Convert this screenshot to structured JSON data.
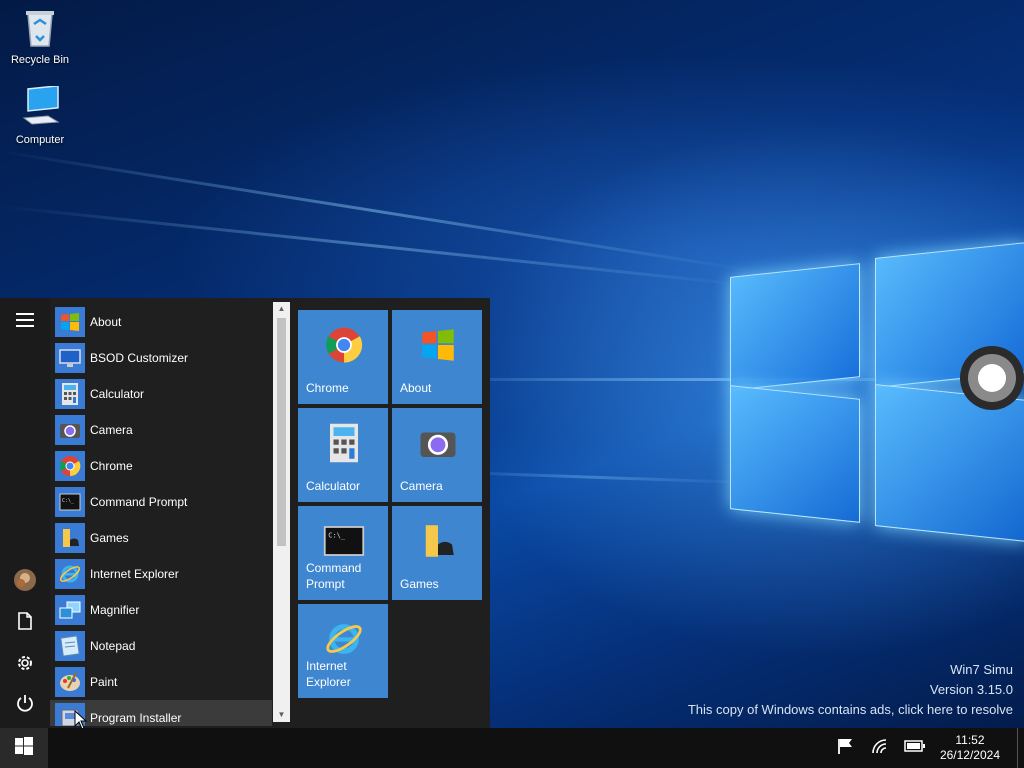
{
  "desktop": {
    "icons": [
      {
        "label": "Recycle Bin",
        "icon": "recycle-bin-icon"
      },
      {
        "label": "Computer",
        "icon": "computer-icon"
      }
    ],
    "watermark": {
      "line1": "Win7 Simu",
      "line2": "Version 3.15.0",
      "line3": "This copy of Windows contains ads, click here to resolve"
    }
  },
  "start_menu": {
    "rail": [
      {
        "icon": "hamburger-menu-icon"
      },
      {
        "icon": "user-avatar-icon"
      },
      {
        "icon": "documents-icon"
      },
      {
        "icon": "settings-gear-icon"
      },
      {
        "icon": "power-icon"
      }
    ],
    "apps": [
      {
        "label": "About",
        "icon": "windows-flag-icon"
      },
      {
        "label": "BSOD Customizer",
        "icon": "monitor-icon"
      },
      {
        "label": "Calculator",
        "icon": "calculator-icon"
      },
      {
        "label": "Camera",
        "icon": "camera-icon"
      },
      {
        "label": "Chrome",
        "icon": "chrome-icon"
      },
      {
        "label": "Command Prompt",
        "icon": "command-prompt-icon"
      },
      {
        "label": "Games",
        "icon": "games-folder-icon"
      },
      {
        "label": "Internet Explorer",
        "icon": "internet-explorer-icon"
      },
      {
        "label": "Magnifier",
        "icon": "magnifier-icon"
      },
      {
        "label": "Notepad",
        "icon": "notepad-icon"
      },
      {
        "label": "Paint",
        "icon": "paint-palette-icon"
      },
      {
        "label": "Program Installer",
        "icon": "installer-icon"
      }
    ],
    "hovered_app": "Program Installer",
    "tiles": [
      {
        "label": "Chrome",
        "icon": "chrome-icon"
      },
      {
        "label": "About",
        "icon": "windows-flag-icon"
      },
      {
        "label": "Calculator",
        "icon": "calculator-icon"
      },
      {
        "label": "Camera",
        "icon": "camera-icon"
      },
      {
        "label_line1": "Command",
        "label_line2": "Prompt",
        "icon": "command-prompt-icon"
      },
      {
        "label": "Games",
        "icon": "games-folder-icon"
      },
      {
        "label_line1": "Internet",
        "label_line2": "Explorer",
        "icon": "internet-explorer-icon"
      }
    ]
  },
  "taskbar": {
    "start_icon": "windows-start-icon",
    "tray": [
      "action-center-flag-icon",
      "network-signal-icon",
      "battery-icon"
    ],
    "time": "11:52",
    "date": "26/12/2024"
  },
  "colors": {
    "tile": "#3f86d0",
    "start_bg": "#1f1f1f",
    "taskbar": "#101010",
    "accent_blue": "#3a7bd5"
  }
}
